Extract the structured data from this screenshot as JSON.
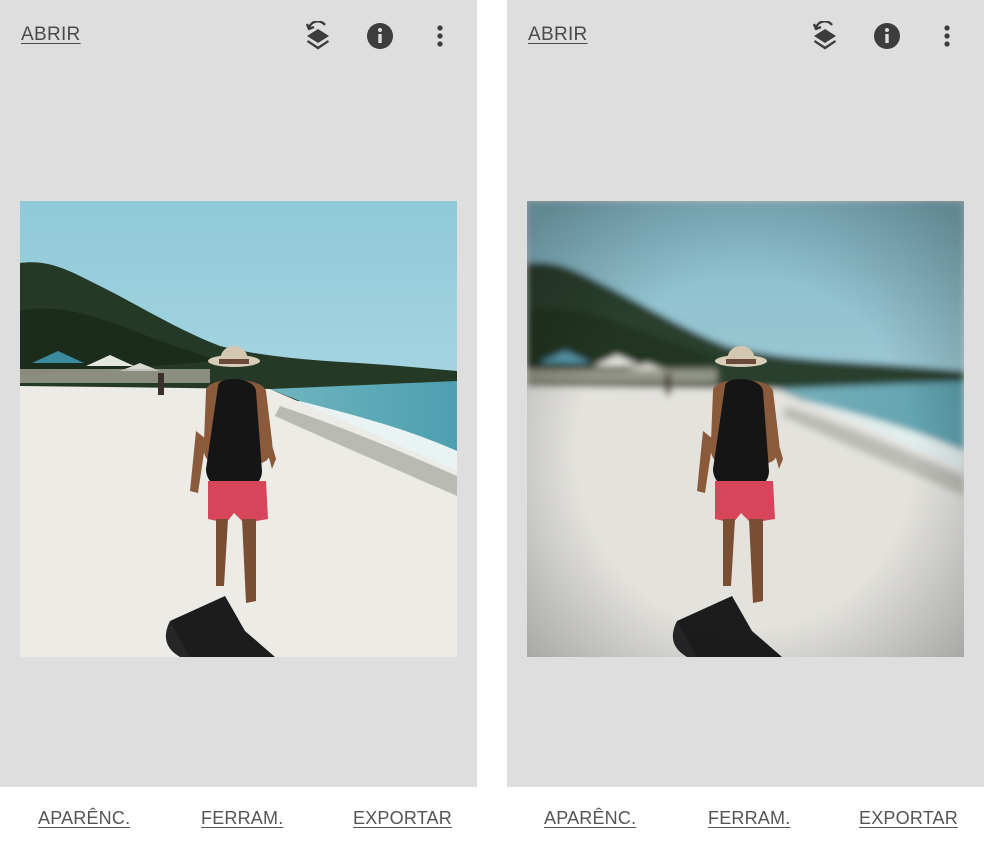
{
  "screens": [
    {
      "open_label": "ABRIR",
      "nav": {
        "looks": "APARÊNC.",
        "tools": "FERRAM.",
        "export": "EXPORTAR"
      },
      "photo_style": "original"
    },
    {
      "open_label": "ABRIR",
      "nav": {
        "looks": "APARÊNC.",
        "tools": "FERRAM.",
        "export": "EXPORTAR"
      },
      "photo_style": "lens-blur"
    }
  ],
  "icons": {
    "stack": "layers-history-icon",
    "info": "info-icon",
    "more": "more-vert-icon"
  },
  "colors": {
    "canvas_bg": "#dedede",
    "bottom_bg": "#ffffff",
    "text": "#4a4a4a",
    "icon": "#3d3d3d"
  }
}
